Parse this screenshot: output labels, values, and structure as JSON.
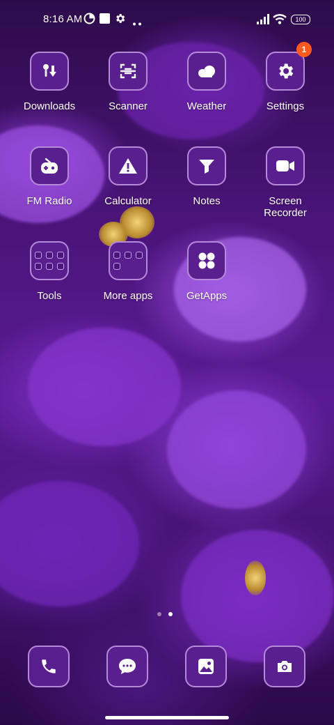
{
  "status_bar": {
    "time": "8:16 AM",
    "battery": "100",
    "icons": [
      "data-saver-icon",
      "notification-square-icon",
      "settings-gear-icon",
      "more-dots-icon",
      "signal-icon",
      "wifi-icon",
      "battery-icon"
    ]
  },
  "apps": [
    {
      "label": "Downloads",
      "icon": "downloads-icon"
    },
    {
      "label": "Scanner",
      "icon": "scanner-icon"
    },
    {
      "label": "Weather",
      "icon": "weather-icon"
    },
    {
      "label": "Settings",
      "icon": "gear-icon",
      "badge": "1"
    },
    {
      "label": "FM Radio",
      "icon": "radio-icon"
    },
    {
      "label": "Calculator",
      "icon": "calculator-icon"
    },
    {
      "label": "Notes",
      "icon": "notes-icon"
    },
    {
      "label": "Screen\nRecorder",
      "icon": "video-camera-icon"
    },
    {
      "label": "Tools",
      "icon": "folder-icon"
    },
    {
      "label": "More apps",
      "icon": "folder-icon"
    },
    {
      "label": "GetApps",
      "icon": "getapps-icon"
    }
  ],
  "dock": [
    {
      "name": "phone",
      "icon": "phone-icon"
    },
    {
      "name": "messages",
      "icon": "message-icon"
    },
    {
      "name": "gallery",
      "icon": "gallery-icon"
    },
    {
      "name": "camera",
      "icon": "camera-icon"
    }
  ],
  "page_indicator": {
    "pages": 2,
    "current": 2
  },
  "colors": {
    "tile": "#5a1f8e",
    "tile_border": "#b58bd9",
    "badge": "#ff5a1f",
    "wallpaper": "#5a1b93"
  }
}
